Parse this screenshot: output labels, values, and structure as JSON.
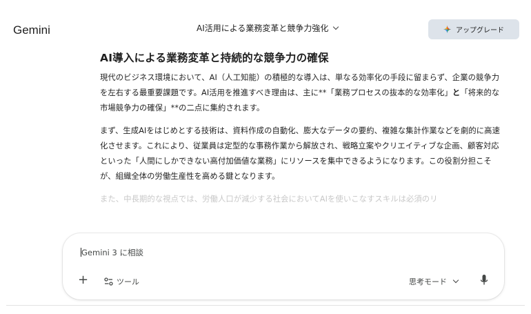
{
  "app": {
    "brand": "Gemini"
  },
  "header": {
    "chat_title": "AI活用による業務変革と競争力強化",
    "upgrade_label": "アップグレード"
  },
  "response": {
    "heading": "AI導入による業務変革と持続的な競争力の確保",
    "p1_a": "現代のビジネス環境において、AI（人工知能）の積極的な導入は、単なる効率化の手段に留まらず、企業の競争力を左右する最重要課題です。AI活用を推進すべき理由は、主に**「業務プロセスの抜本的な効率化」",
    "p1_b": "と",
    "p1_c": "「将来的な市場競争力の確保」**の二点に集約されます。",
    "p2": "まず、生成AIをはじめとする技術は、資料作成の自動化、膨大なデータの要約、複雑な集計作業などを劇的に高速化させます。これにより、従業員は定型的な事務作業から解放され、戦略立案やクリエイティブな企画、顧客対応といった「人間にしかできない高付加価値な業務」にリソースを集中できるようになります。この役割分担こそが、組織全体の労働生産性を高める鍵となります。",
    "p3_partial": "また、中長期的な視点では、労働人口が減少する社会においてAIを使いこなすスキルは必須のリ"
  },
  "composer": {
    "placeholder": "Gemini 3 に相談",
    "tools_label": "ツール",
    "mode_label": "思考モード"
  },
  "colors": {
    "upgrade_bg": "#dde3ea",
    "spark_blue": "#4285f4",
    "spark_red": "#ea4335",
    "spark_yellow": "#fbbc04",
    "spark_green": "#34a853"
  }
}
